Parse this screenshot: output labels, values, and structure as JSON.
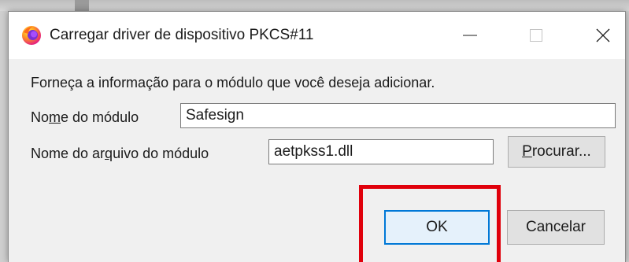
{
  "dialog": {
    "title": "Carregar driver de dispositivo PKCS#11",
    "app_icon": "firefox-icon",
    "controls": {
      "minimize": "minimize-icon",
      "maximize": "maximize-icon",
      "close": "close-icon"
    }
  },
  "form": {
    "instruction": "Forneça a informação para o módulo que você deseja adicionar.",
    "module_name": {
      "label_before": "No",
      "label_accel": "m",
      "label_after": "e do módulo",
      "value": "Safesign"
    },
    "module_file": {
      "label_before": "Nome do ar",
      "label_accel": "q",
      "label_after": "uivo do módulo",
      "value": "aetpkss1.dll"
    },
    "browse": {
      "label_accel": "P",
      "label_rest": "rocurar..."
    }
  },
  "buttons": {
    "ok": "OK",
    "cancel": "Cancelar"
  },
  "colors": {
    "highlight": "#e0000b",
    "focus_border": "#0078d7",
    "titlebar": "#ffffff",
    "dialog_bg": "#f0f0f0"
  }
}
